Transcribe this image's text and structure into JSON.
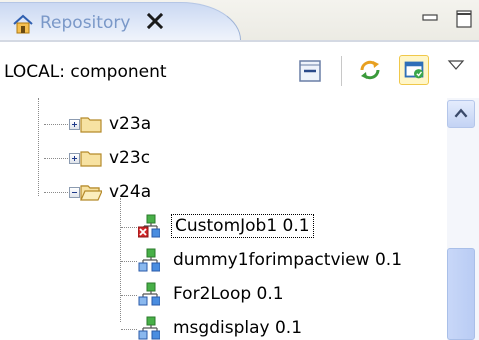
{
  "tab": {
    "title": "Repository",
    "icon": "repository-home-icon",
    "close_icon": "close-x-icon"
  },
  "view_controls": {
    "minimize_icon": "minimize-icon",
    "maximize_icon": "maximize-icon"
  },
  "toolbar": {
    "path_label": "LOCAL: component",
    "buttons": [
      "collapse-all-icon",
      "refresh-icon",
      "link-with-editor-icon",
      "view-menu-icon"
    ]
  },
  "tree": {
    "items": [
      {
        "label": "v23a",
        "type": "folder",
        "expanded": false
      },
      {
        "label": "v23c",
        "type": "folder",
        "expanded": false
      },
      {
        "label": "v24a",
        "type": "folder",
        "expanded": true
      },
      {
        "label": "CustomJob1 0.1",
        "type": "job",
        "status": "error",
        "focused": true
      },
      {
        "label": "dummy1forimpactview 0.1",
        "type": "job"
      },
      {
        "label": "For2Loop 0.1",
        "type": "job"
      },
      {
        "label": "msgdisplay 0.1",
        "type": "job"
      }
    ]
  },
  "colors": {
    "tab_gradient": "#cad8f2",
    "tab_text": "#7a98c8",
    "folder": "#f5d98a",
    "job_green": "#3faa3f",
    "job_blue": "#4a8de0",
    "error_red": "#d0282a"
  }
}
